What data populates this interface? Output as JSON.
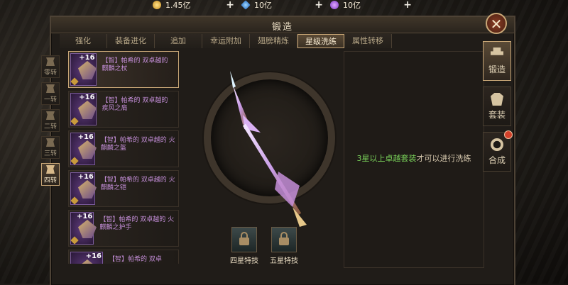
{
  "resources": [
    {
      "icon": "gold-coin-icon",
      "value": "1.45亿"
    },
    {
      "icon": "blue-gem-icon",
      "value": "10亿"
    },
    {
      "icon": "purple-crystal-icon",
      "value": "10亿"
    }
  ],
  "window": {
    "title": "锻造",
    "close_icon": "close-icon"
  },
  "tabs": [
    "强化",
    "装备进化",
    "追加",
    "幸运附加",
    "翅膀精炼",
    "星级洗练",
    "属性转移"
  ],
  "active_tab": "星级洗练",
  "rebirth_tabs": [
    "零转",
    "一转",
    "二转",
    "三转",
    "四转"
  ],
  "active_rebirth": "四转",
  "items": [
    {
      "level": "+16",
      "name": "【智】帕希的 双卓越的 麒麟之杖",
      "selected": true
    },
    {
      "level": "+16",
      "name": "【智】帕希的 双卓越的 疾风之肩",
      "selected": false
    },
    {
      "level": "+16",
      "name": "【智】帕希的 双卓越的 火麒麟之盔",
      "selected": false
    },
    {
      "level": "+16",
      "name": "【智】帕希的 双卓越的 火麒麟之铠",
      "selected": false
    },
    {
      "level": "+16",
      "name": "【智】帕希的 双卓越的 火麒麟之护手",
      "selected": false
    },
    {
      "level": "+16",
      "name": "【智】帕希的 双卓",
      "selected": false
    }
  ],
  "skills": [
    {
      "label": "四星特技"
    },
    {
      "label": "五星特技"
    }
  ],
  "notice": {
    "highlight": "3星以上卓越套装",
    "rest": "才可以进行洗练"
  },
  "side_tabs": [
    {
      "label": "锻造",
      "active": true,
      "badge": false
    },
    {
      "label": "套装",
      "active": false,
      "badge": false
    },
    {
      "label": "合成",
      "active": false,
      "badge": true
    }
  ],
  "colors": {
    "accent": "#c9a777",
    "notice_highlight": "#7ad35a",
    "item_name": "#c48ed8"
  }
}
